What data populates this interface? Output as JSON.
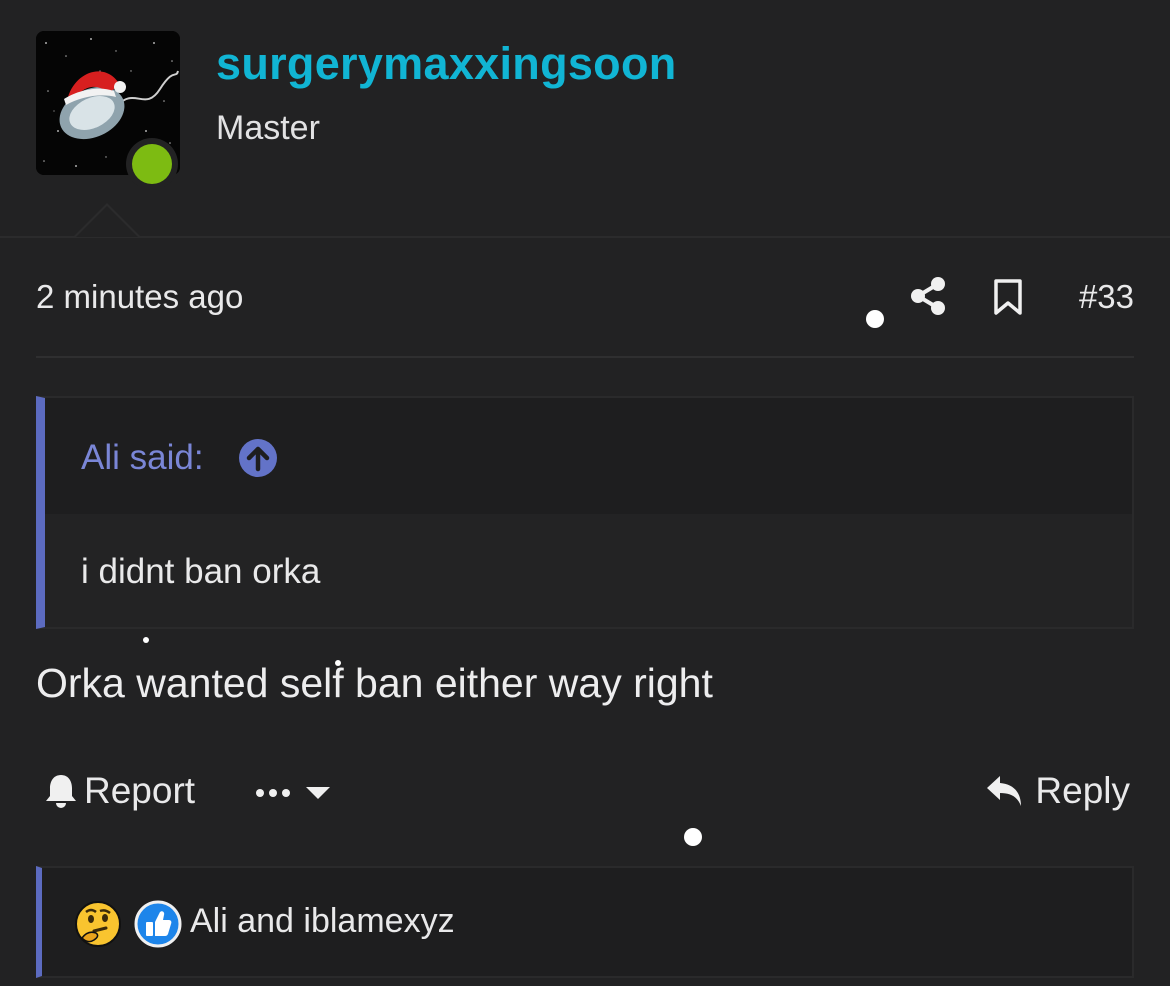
{
  "user": {
    "username": "surgerymaxxingsoon",
    "title": "Master",
    "online": true,
    "username_color": "#11b5d4",
    "online_color": "#7dbb12"
  },
  "post": {
    "timestamp": "2 minutes ago",
    "post_number": "#33",
    "body": "Orka wanted self ban either way right"
  },
  "quote": {
    "author_label": "Ali said:",
    "text": "i didnt ban orka",
    "accent_color": "#5c6bc0"
  },
  "actions": {
    "report_label": "Report",
    "reply_label": "Reply"
  },
  "reactions": {
    "icons": [
      "thinking-face-icon",
      "like-icon"
    ],
    "users_label": "Ali and iblamexyz"
  },
  "icons": {
    "share": "share-icon",
    "bookmark": "bookmark-icon",
    "quote_jump": "arrow-up-circle-icon",
    "report": "bell-icon",
    "more": "more-dots-icon",
    "reply": "reply-arrow-icon"
  }
}
